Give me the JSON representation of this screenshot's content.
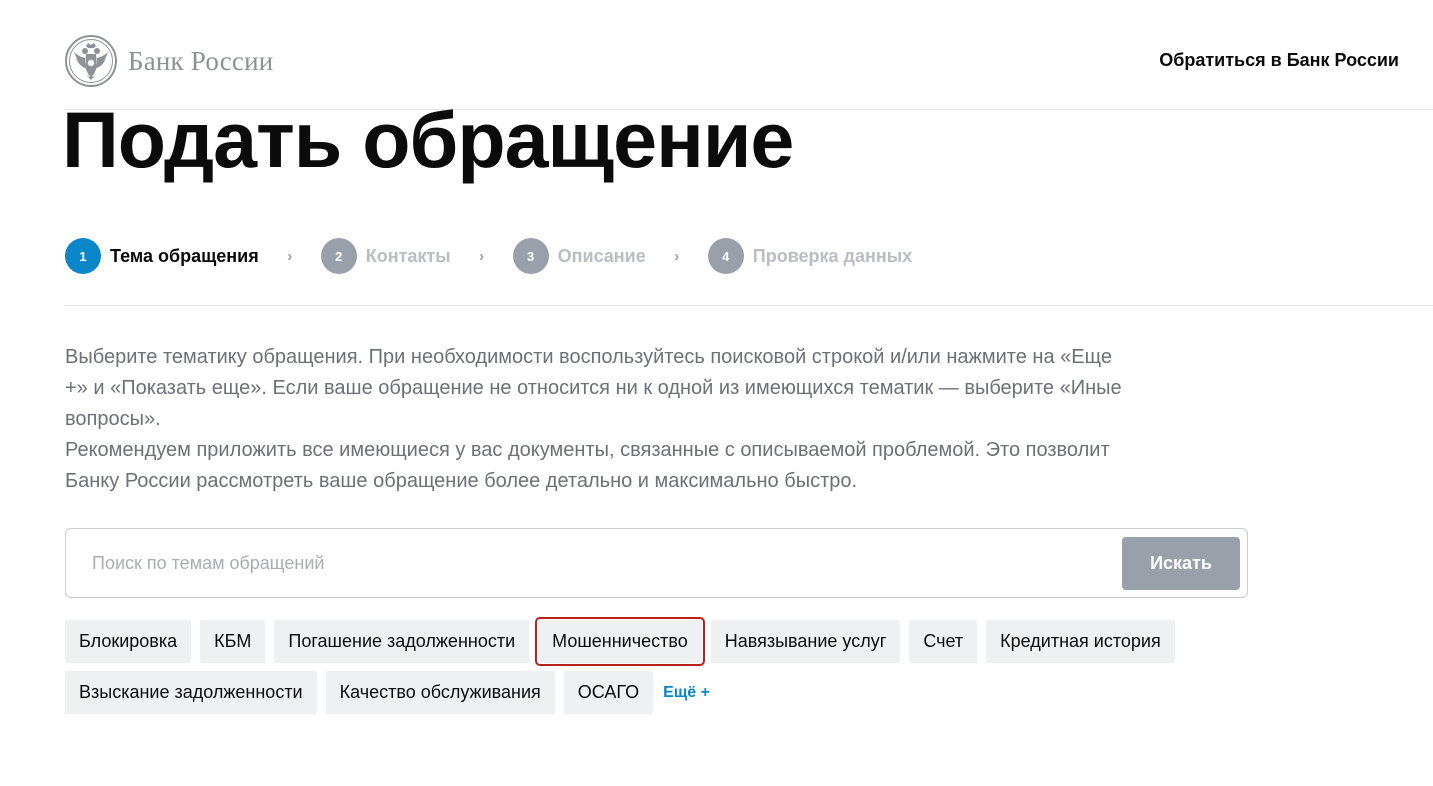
{
  "header": {
    "logo_text": "Банк России",
    "logo_icon": "double-headed-eagle-emblem",
    "contact_link": "Обратиться в Банк России"
  },
  "page": {
    "title": "Подать обращение"
  },
  "steps": [
    {
      "number": "1",
      "label": "Тема обращения",
      "active": true
    },
    {
      "number": "2",
      "label": "Контакты",
      "active": false
    },
    {
      "number": "3",
      "label": "Описание",
      "active": false
    },
    {
      "number": "4",
      "label": "Проверка данных",
      "active": false
    }
  ],
  "step_separator": "›",
  "description": {
    "paragraph_1": "Выберите тематику обращения. При необходимости воспользуйтесь поисковой строкой и/или нажмите на «Еще +» и «Показать еще». Если ваше обращение не относится ни к одной из имеющихся тематик — выберите «Иные вопросы».",
    "paragraph_2": "Рекомендуем приложить все имеющиеся у вас документы, связанные с описываемой проблемой. Это позволит Банку России рассмотреть ваше обращение более детально и максимально быстро."
  },
  "search": {
    "placeholder": "Поиск по темам обращений",
    "value": "",
    "button_label": "Искать"
  },
  "tags": {
    "row1": [
      "Блокировка",
      "КБМ",
      "Погашение задолженности",
      "Мошенничество",
      "Навязывание услуг",
      "Счет",
      "Кредитная история"
    ],
    "row2": [
      "Взыскание задолженности",
      "Качество обслуживания",
      "ОСАГО"
    ],
    "highlighted": "Мошенничество",
    "more_label": "Ещё +"
  },
  "colors": {
    "accent": "#0a86c9",
    "step_inactive": "#9aa0aa",
    "highlight_border": "#b8221a",
    "tag_background": "#eff0f2"
  }
}
